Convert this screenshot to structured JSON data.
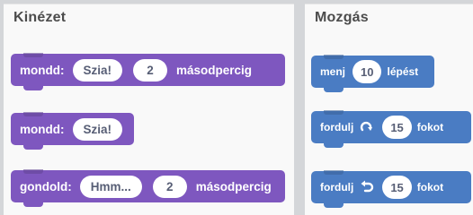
{
  "looks": {
    "title": "Kinézet",
    "say_for_secs": {
      "label": "mondd:",
      "text": "Szia!",
      "secs": "2",
      "unit": "másodpercig"
    },
    "say": {
      "label": "mondd:",
      "text": "Szia!"
    },
    "think_for_secs": {
      "label": "gondold:",
      "text": "Hmm...",
      "secs": "2",
      "unit": "másodpercig"
    },
    "color": "#7e57bf"
  },
  "motion": {
    "title": "Mozgás",
    "move": {
      "label": "menj",
      "steps": "10",
      "unit": "lépést"
    },
    "turn_right": {
      "label": "fordulj",
      "icon": "rotate-clockwise-icon",
      "degrees": "15",
      "unit": "fokot"
    },
    "turn_left": {
      "label": "fordulj",
      "icon": "rotate-counterclockwise-icon",
      "degrees": "15",
      "unit": "fokot"
    },
    "color": "#4a7cc3"
  }
}
